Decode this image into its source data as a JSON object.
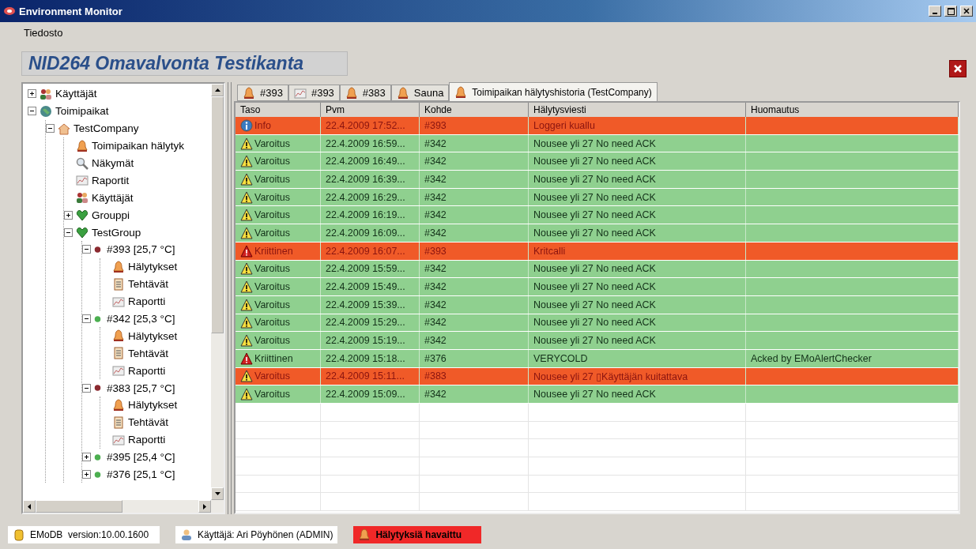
{
  "window": {
    "title": "Environment Monitor"
  },
  "menu": [
    "Tiedosto"
  ],
  "header": {
    "title": "NID264 Omavalvonta Testikanta"
  },
  "tree": [
    {
      "label": "Käyttäjät",
      "kind": "users",
      "expanded": false
    },
    {
      "label": "Toimipaikat",
      "kind": "globe",
      "expanded": true,
      "children": [
        {
          "label": "TestCompany",
          "kind": "house",
          "expanded": true,
          "children": [
            {
              "label": "Toimipaikan hälytyk",
              "kind": "bell"
            },
            {
              "label": "Näkymät",
              "kind": "search"
            },
            {
              "label": "Raportit",
              "kind": "chart"
            },
            {
              "label": "Käyttäjät",
              "kind": "users"
            },
            {
              "label": "Grouppi",
              "kind": "group",
              "expanded": false
            },
            {
              "label": "TestGroup",
              "kind": "group",
              "expanded": true,
              "children": [
                {
                  "label": "#393 [25,7 °C]",
                  "kind": "dot",
                  "color": "#8b2a30",
                  "expanded": true,
                  "children": [
                    {
                      "label": "Hälytykset",
                      "kind": "bell"
                    },
                    {
                      "label": "Tehtävät",
                      "kind": "clipboard"
                    },
                    {
                      "label": "Raportti",
                      "kind": "chart"
                    }
                  ]
                },
                {
                  "label": "#342 [25,3 °C]",
                  "kind": "dot",
                  "color": "#4caf50",
                  "expanded": true,
                  "children": [
                    {
                      "label": "Hälytykset",
                      "kind": "bell"
                    },
                    {
                      "label": "Tehtävät",
                      "kind": "clipboard"
                    },
                    {
                      "label": "Raportti",
                      "kind": "chart"
                    }
                  ]
                },
                {
                  "label": "#383 [25,7 °C]",
                  "kind": "dot",
                  "color": "#8b2a30",
                  "expanded": true,
                  "children": [
                    {
                      "label": "Hälytykset",
                      "kind": "bell"
                    },
                    {
                      "label": "Tehtävät",
                      "kind": "clipboard"
                    },
                    {
                      "label": "Raportti",
                      "kind": "chart"
                    }
                  ]
                },
                {
                  "label": "#395 [25,4 °C]",
                  "kind": "dot",
                  "color": "#4caf50",
                  "expanded": false
                },
                {
                  "label": "#376 [25,1 °C]",
                  "kind": "dot",
                  "color": "#4caf50",
                  "expanded": false
                }
              ]
            }
          ]
        }
      ]
    }
  ],
  "tabs": [
    {
      "label": "#393",
      "kind": "bell",
      "selected": false
    },
    {
      "label": "#393",
      "kind": "chart",
      "selected": false
    },
    {
      "label": "#383",
      "kind": "bell",
      "selected": false
    },
    {
      "label": "Sauna",
      "kind": "bell",
      "selected": false
    },
    {
      "label": "Toimipaikan hälytyshistoria (TestCompany)",
      "kind": "bell",
      "selected": true
    }
  ],
  "table": {
    "columns": [
      "Taso",
      "Pvm",
      "Kohde",
      "Hälytysviesti",
      "Huomautus"
    ],
    "rows": [
      {
        "kind": "info",
        "color": "#f05a28",
        "cells": [
          "Info",
          "22.4.2009 17:52...",
          "#393",
          "Loggeri kuallu",
          ""
        ]
      },
      {
        "kind": "warning",
        "color": "#8fd08f",
        "cells": [
          "Varoitus",
          "22.4.2009 16:59...",
          "#342",
          "Nousee yli 27 No need ACK",
          ""
        ]
      },
      {
        "kind": "warning",
        "color": "#8fd08f",
        "cells": [
          "Varoitus",
          "22.4.2009 16:49...",
          "#342",
          "Nousee yli 27 No need ACK",
          ""
        ]
      },
      {
        "kind": "warning",
        "color": "#8fd08f",
        "cells": [
          "Varoitus",
          "22.4.2009 16:39...",
          "#342",
          "Nousee yli 27 No need ACK",
          ""
        ]
      },
      {
        "kind": "warning",
        "color": "#8fd08f",
        "cells": [
          "Varoitus",
          "22.4.2009 16:29...",
          "#342",
          "Nousee yli 27 No need ACK",
          ""
        ]
      },
      {
        "kind": "warning",
        "color": "#8fd08f",
        "cells": [
          "Varoitus",
          "22.4.2009 16:19...",
          "#342",
          "Nousee yli 27 No need ACK",
          ""
        ]
      },
      {
        "kind": "warning",
        "color": "#8fd08f",
        "cells": [
          "Varoitus",
          "22.4.2009 16:09...",
          "#342",
          "Nousee yli 27 No need ACK",
          ""
        ]
      },
      {
        "kind": "critical",
        "color": "#f05a28",
        "cells": [
          "Kriittinen",
          "22.4.2009 16:07...",
          "#393",
          "Kritcalli",
          ""
        ]
      },
      {
        "kind": "warning",
        "color": "#8fd08f",
        "cells": [
          "Varoitus",
          "22.4.2009 15:59...",
          "#342",
          "Nousee yli 27 No need ACK",
          ""
        ]
      },
      {
        "kind": "warning",
        "color": "#8fd08f",
        "cells": [
          "Varoitus",
          "22.4.2009 15:49...",
          "#342",
          "Nousee yli 27 No need ACK",
          ""
        ]
      },
      {
        "kind": "warning",
        "color": "#8fd08f",
        "cells": [
          "Varoitus",
          "22.4.2009 15:39...",
          "#342",
          "Nousee yli 27 No need ACK",
          ""
        ]
      },
      {
        "kind": "warning",
        "color": "#8fd08f",
        "cells": [
          "Varoitus",
          "22.4.2009 15:29...",
          "#342",
          "Nousee yli 27 No need ACK",
          ""
        ]
      },
      {
        "kind": "warning",
        "color": "#8fd08f",
        "cells": [
          "Varoitus",
          "22.4.2009 15:19...",
          "#342",
          "Nousee yli 27 No need ACK",
          ""
        ]
      },
      {
        "kind": "critical",
        "color": "#8fd08f",
        "cells": [
          "Kriittinen",
          "22.4.2009 15:18...",
          "#376",
          "VERYCOLD",
          "Acked by EMoAlertChecker"
        ]
      },
      {
        "kind": "warning",
        "color": "#f05a28",
        "cells": [
          "Varoitus",
          "22.4.2009 15:11...",
          "#383",
          "Nousee yli 27 ▯Käyttäjän kuitattava",
          ""
        ]
      },
      {
        "kind": "warning",
        "color": "#8fd08f",
        "cells": [
          "Varoitus",
          "22.4.2009 15:09...",
          "#342",
          "Nousee yli 27 No need ACK",
          ""
        ]
      }
    ]
  },
  "status_bar": [
    {
      "kind": "database",
      "text": "EMoDB  version:10.00.1600",
      "alert": false
    },
    {
      "kind": "user",
      "text": "Käyttäjä: Ari Pöyhönen (ADMIN)",
      "alert": false
    },
    {
      "kind": "bell",
      "text": "Hälytyksiä havaittu",
      "alert": true
    }
  ]
}
